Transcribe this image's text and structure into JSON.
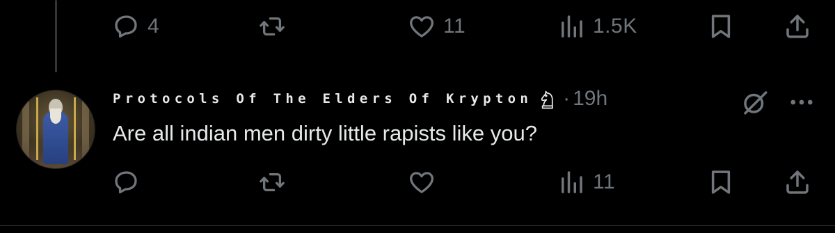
{
  "parent_post": {
    "actions": {
      "reply_count": "4",
      "retweet_count": "",
      "like_count": "11",
      "views_count": "1.5K"
    }
  },
  "reply_post": {
    "author_display_name": "Protocols Of The Elders Of Krypton",
    "separator": "·",
    "timestamp": "19h",
    "text": "Are all indian men dirty little rapists like you?",
    "actions": {
      "reply_count": "",
      "retweet_count": "",
      "like_count": "",
      "views_count": "11"
    }
  },
  "icons": {
    "reply": "speech-bubble-icon",
    "retweet": "retweet-icon",
    "like": "heart-icon",
    "views": "bar-chart-icon",
    "bookmark": "bookmark-icon",
    "share": "share-upload-icon",
    "grok": "grok-icon",
    "more": "more-dots-icon",
    "badge": "chess-knight-badge-icon"
  },
  "colors": {
    "background": "#000000",
    "primary_text": "#e7e9ea",
    "secondary_text": "#71767b",
    "thread_line": "#333639"
  }
}
